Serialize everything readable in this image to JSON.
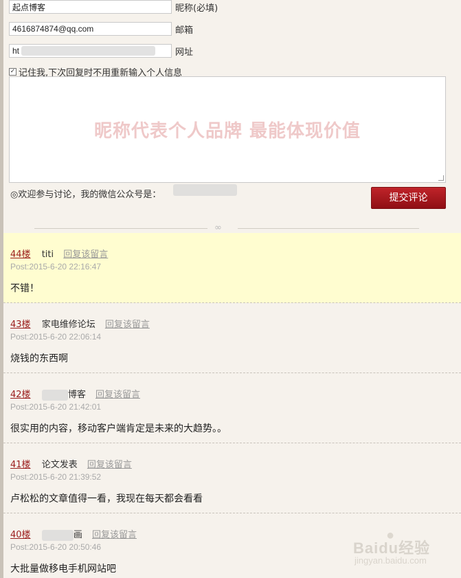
{
  "form": {
    "nickname_value": "起点博客",
    "nickname_label": "昵称(必填)",
    "email_value": "4616874874@qq.com",
    "email_label": "邮箱",
    "url_value": "ht",
    "url_label": "网址",
    "remember_label": "记住我,下次回复时不用重新输入个人信息",
    "remember_checked": true,
    "textarea_slogan": "昵称代表个人品牌 最能体现价值",
    "wechat_note": "◎欢迎参与讨论，我的微信公众号是：",
    "submit_label": "提交评论"
  },
  "comments": [
    {
      "floor": "44楼",
      "author": "titi",
      "reply": "回复该留言",
      "time": "Post:2015-6-20 22:16:47",
      "body": "不错！",
      "highlight": true
    },
    {
      "floor": "43楼",
      "author": "家电维修论坛",
      "reply": "回复该留言",
      "time": "Post:2015-6-20 22:06:14",
      "body": "烧钱的东西啊"
    },
    {
      "floor": "42楼",
      "author": "博客",
      "reply": "回复该留言",
      "time": "Post:2015-6-20 21:42:01",
      "body": "很实用的内容，移动客户端肯定是未来的大趋势。。"
    },
    {
      "floor": "41楼",
      "author": "论文发表",
      "reply": "回复该留言",
      "time": "Post:2015-6-20 21:39:52",
      "body": "卢松松的文章值得一看，我现在每天都会看看"
    },
    {
      "floor": "40楼",
      "author": "画",
      "reply": "回复该留言",
      "time": "Post:2015-6-20 20:50:46",
      "body": "大批量做移电手机网站吧"
    }
  ],
  "watermark": {
    "main": "Baidu经验",
    "sub": "jingyan.baidu.com"
  },
  "colors": {
    "accent": "#9b1c1c",
    "button": "#a81a20",
    "highlight": "#fffdd0",
    "page_bg": "#f6f2ec"
  }
}
